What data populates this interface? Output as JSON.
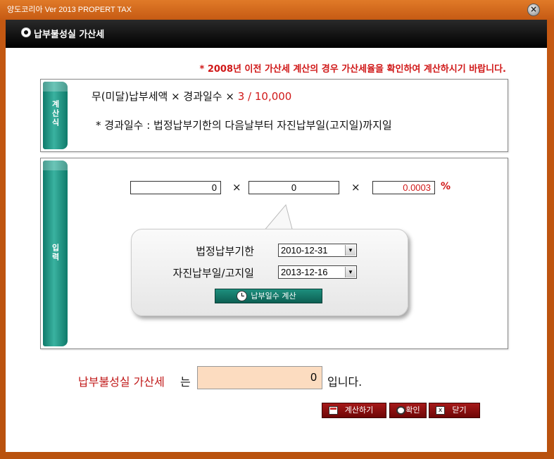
{
  "window": {
    "title": "양도코리아 Ver 2013  PROPERT TAX",
    "close_glyph": "×"
  },
  "header": {
    "title": "납부불성실 가산세"
  },
  "notice": "* 2008년 이전 가산세 계산의 경우 가산세율을 확인하여 계산하시기 바랍니다.",
  "formula_panel": {
    "side_label": "계산식",
    "formula_prefix": "무(미달)납부세액 × 경과일수 ×",
    "formula_rate": "3 / 10,000",
    "note": "* 경과일수 : 법정납부기한의 다음날부터 자진납부일(고지일)까지일"
  },
  "input_panel": {
    "side_label": "입력",
    "tax_amount": "0",
    "days": "0",
    "rate": "0.0003",
    "times": "×",
    "percent": "%",
    "due_date_label": "법정납부기한",
    "due_date": "2010-12-31",
    "payment_date_label": "자진납부일/고지일",
    "payment_date": "2013-12-16",
    "calc_days_button": "납부일수 계산",
    "dropdown_glyph": "▼"
  },
  "result": {
    "label_red": "납부불성실 가산세",
    "label_suffix": "는",
    "value": "0",
    "unit": "입니다."
  },
  "footer": {
    "calculate_button": "계산하기",
    "confirm_button": "확인",
    "close_button": "닫기",
    "close_glyph": "x"
  },
  "colors": {
    "accent_red": "#d01818",
    "teal": "#1d8f7d",
    "frame_orange": "#c85a14",
    "result_fill": "#fcdcc0"
  }
}
